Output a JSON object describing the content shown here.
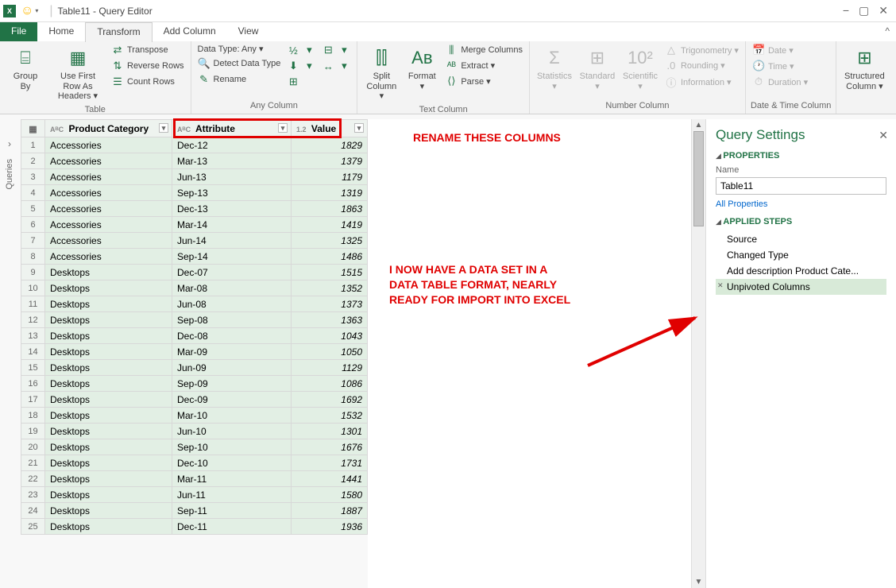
{
  "titlebar": {
    "title": "Table11 - Query Editor"
  },
  "tabs": {
    "file": "File",
    "home": "Home",
    "transform": "Transform",
    "addcol": "Add Column",
    "view": "View"
  },
  "ribbon": {
    "table": {
      "label": "Table",
      "group_by": "Group\nBy",
      "use_first": "Use First Row\nAs Headers ▾",
      "transpose": "Transpose",
      "reverse": "Reverse Rows",
      "count": "Count Rows"
    },
    "anycol": {
      "label": "Any Column",
      "datatype": "Data Type: Any ▾",
      "detect": "Detect Data Type",
      "rename": "Rename"
    },
    "textcol": {
      "label": "Text Column",
      "split": "Split\nColumn ▾",
      "format": "Format\n▾",
      "merge": "Merge Columns",
      "extract": "Extract ▾",
      "parse": "Parse ▾"
    },
    "numcol": {
      "label": "Number Column",
      "stats": "Statistics\n▾",
      "standard": "Standard\n▾",
      "scientific": "Scientific\n▾",
      "trig": "Trigonometry ▾",
      "round": "Rounding ▾",
      "info": "Information ▾"
    },
    "dtcol": {
      "label": "Date & Time Column",
      "date": "Date ▾",
      "time": "Time ▾",
      "duration": "Duration ▾"
    },
    "struct": {
      "label": "",
      "btn": "Structured\nColumn ▾"
    }
  },
  "columns": {
    "c1": "Product Category",
    "c2": "Attribute",
    "c3": "Value"
  },
  "rows": [
    {
      "pc": "Accessories",
      "attr": "Dec-12",
      "val": "1829"
    },
    {
      "pc": "Accessories",
      "attr": "Mar-13",
      "val": "1379"
    },
    {
      "pc": "Accessories",
      "attr": "Jun-13",
      "val": "1179"
    },
    {
      "pc": "Accessories",
      "attr": "Sep-13",
      "val": "1319"
    },
    {
      "pc": "Accessories",
      "attr": "Dec-13",
      "val": "1863"
    },
    {
      "pc": "Accessories",
      "attr": "Mar-14",
      "val": "1419"
    },
    {
      "pc": "Accessories",
      "attr": "Jun-14",
      "val": "1325"
    },
    {
      "pc": "Accessories",
      "attr": "Sep-14",
      "val": "1486"
    },
    {
      "pc": "Desktops",
      "attr": "Dec-07",
      "val": "1515"
    },
    {
      "pc": "Desktops",
      "attr": "Mar-08",
      "val": "1352"
    },
    {
      "pc": "Desktops",
      "attr": "Jun-08",
      "val": "1373"
    },
    {
      "pc": "Desktops",
      "attr": "Sep-08",
      "val": "1363"
    },
    {
      "pc": "Desktops",
      "attr": "Dec-08",
      "val": "1043"
    },
    {
      "pc": "Desktops",
      "attr": "Mar-09",
      "val": "1050"
    },
    {
      "pc": "Desktops",
      "attr": "Jun-09",
      "val": "1129"
    },
    {
      "pc": "Desktops",
      "attr": "Sep-09",
      "val": "1086"
    },
    {
      "pc": "Desktops",
      "attr": "Dec-09",
      "val": "1692"
    },
    {
      "pc": "Desktops",
      "attr": "Mar-10",
      "val": "1532"
    },
    {
      "pc": "Desktops",
      "attr": "Jun-10",
      "val": "1301"
    },
    {
      "pc": "Desktops",
      "attr": "Sep-10",
      "val": "1676"
    },
    {
      "pc": "Desktops",
      "attr": "Dec-10",
      "val": "1731"
    },
    {
      "pc": "Desktops",
      "attr": "Mar-11",
      "val": "1441"
    },
    {
      "pc": "Desktops",
      "attr": "Jun-11",
      "val": "1580"
    },
    {
      "pc": "Desktops",
      "attr": "Sep-11",
      "val": "1887"
    },
    {
      "pc": "Desktops",
      "attr": "Dec-11",
      "val": "1936"
    }
  ],
  "annotations": {
    "top": "RENAME THESE COLUMNS",
    "mid": "I NOW HAVE A DATA SET IN A\nDATA TABLE FORMAT, NEARLY\nREADY FOR IMPORT INTO EXCEL"
  },
  "qs": {
    "title": "Query Settings",
    "properties": "PROPERTIES",
    "name_label": "Name",
    "name_value": "Table11",
    "all_props": "All Properties",
    "applied": "APPLIED STEPS",
    "steps": [
      "Source",
      "Changed Type",
      "Add description Product Cate...",
      "Unpivoted Columns"
    ]
  },
  "left": {
    "queries": "Queries"
  }
}
